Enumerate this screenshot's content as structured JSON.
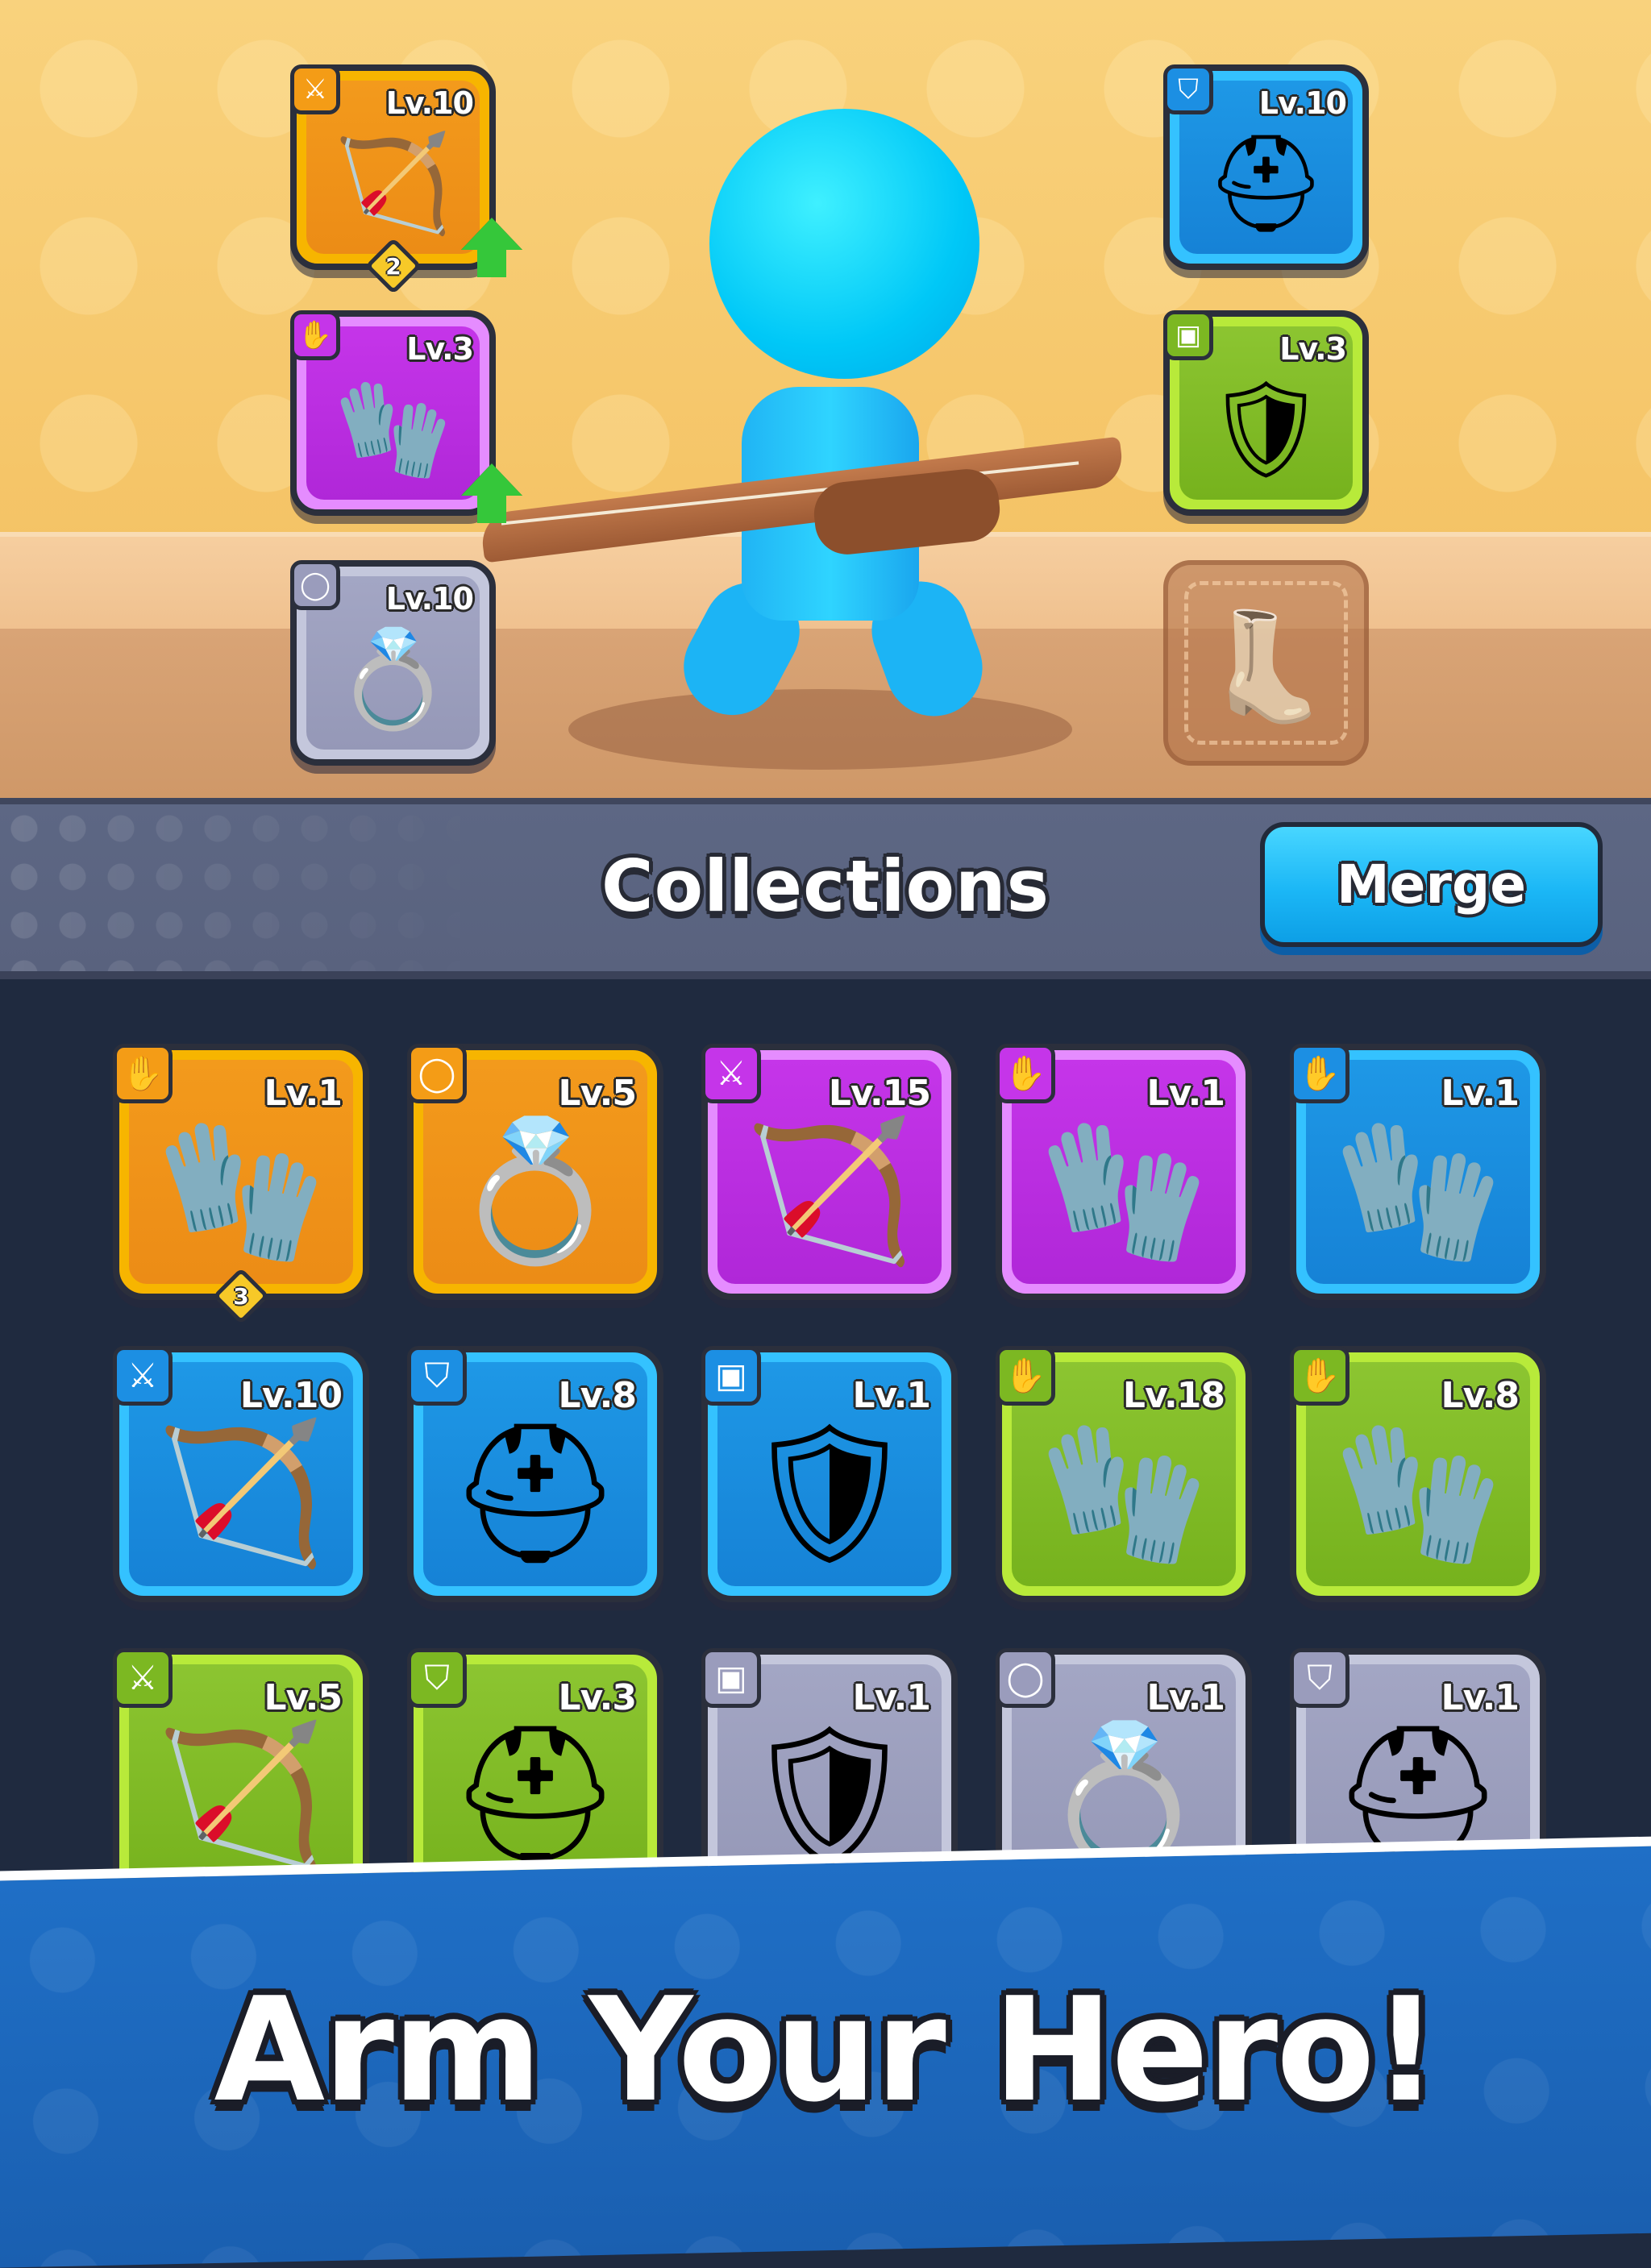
{
  "equipped": [
    {
      "slot": "weapon",
      "level": "Lv.10",
      "rarity": "orange",
      "icon": "bow-icon",
      "glyph": "🏹",
      "tag_glyph": "⚔",
      "badge": "2",
      "upgrade": true
    },
    {
      "slot": "gloves",
      "level": "Lv.3",
      "rarity": "purple",
      "icon": "glove-icon",
      "glyph": "🧤",
      "tag_glyph": "✋",
      "upgrade": true
    },
    {
      "slot": "ring",
      "level": "Lv.10",
      "rarity": "gray",
      "icon": "ring-icon",
      "glyph": "💍",
      "tag_glyph": "◯"
    },
    {
      "slot": "helmet",
      "level": "Lv.10",
      "rarity": "blue",
      "icon": "helmet-icon",
      "glyph": "⛑",
      "tag_glyph": "⛉"
    },
    {
      "slot": "armor",
      "level": "Lv.3",
      "rarity": "green",
      "icon": "armor-icon",
      "glyph": "🛡",
      "tag_glyph": "▣"
    },
    {
      "slot": "boots",
      "empty": true,
      "icon": "boot-icon",
      "glyph": "👢"
    }
  ],
  "collections": {
    "title": "Collections",
    "merge_label": "Merge"
  },
  "grid": [
    {
      "level": "Lv.1",
      "rarity": "orange",
      "icon": "glove-icon",
      "glyph": "🧤",
      "tag_glyph": "✋",
      "badge": "3"
    },
    {
      "level": "Lv.5",
      "rarity": "orange",
      "icon": "ring-icon",
      "glyph": "💍",
      "tag_glyph": "◯"
    },
    {
      "level": "Lv.15",
      "rarity": "purple",
      "icon": "bow-icon",
      "glyph": "🏹",
      "tag_glyph": "⚔"
    },
    {
      "level": "Lv.1",
      "rarity": "purple",
      "icon": "glove-icon",
      "glyph": "🧤",
      "tag_glyph": "✋"
    },
    {
      "level": "Lv.1",
      "rarity": "blue",
      "icon": "glove-icon",
      "glyph": "🧤",
      "tag_glyph": "✋"
    },
    {
      "level": "Lv.10",
      "rarity": "blue",
      "icon": "bow-icon",
      "glyph": "🏹",
      "tag_glyph": "⚔"
    },
    {
      "level": "Lv.8",
      "rarity": "blue",
      "icon": "helmet-icon",
      "glyph": "⛑",
      "tag_glyph": "⛉"
    },
    {
      "level": "Lv.1",
      "rarity": "blue",
      "icon": "armor-icon",
      "glyph": "🛡",
      "tag_glyph": "▣"
    },
    {
      "level": "Lv.18",
      "rarity": "green",
      "icon": "glove-icon",
      "glyph": "🧤",
      "tag_glyph": "✋"
    },
    {
      "level": "Lv.8",
      "rarity": "green",
      "icon": "glove-icon",
      "glyph": "🧤",
      "tag_glyph": "✋"
    },
    {
      "level": "Lv.5",
      "rarity": "green",
      "icon": "bow-icon",
      "glyph": "🏹",
      "tag_glyph": "⚔"
    },
    {
      "level": "Lv.3",
      "rarity": "green",
      "icon": "helmet-icon",
      "glyph": "⛑",
      "tag_glyph": "⛉"
    },
    {
      "level": "Lv.1",
      "rarity": "gray",
      "icon": "armor-icon",
      "glyph": "🛡",
      "tag_glyph": "▣"
    },
    {
      "level": "Lv.1",
      "rarity": "gray",
      "icon": "ring-icon",
      "glyph": "💍",
      "tag_glyph": "◯"
    },
    {
      "level": "Lv.1",
      "rarity": "gray",
      "icon": "helmet-icon",
      "glyph": "⛑",
      "tag_glyph": "⛉"
    }
  ],
  "banner": {
    "text": "Arm Your Hero!"
  }
}
